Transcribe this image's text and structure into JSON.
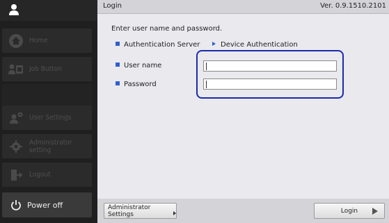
{
  "header": {
    "title": "Login",
    "version": "Ver. 0.9.1510.2101"
  },
  "sidebar": {
    "items": [
      {
        "label": "Home",
        "icon": "home-icon",
        "enabled": false
      },
      {
        "label": "Job Button",
        "icon": "job-button-icon",
        "enabled": false
      },
      {
        "label": "User Settings",
        "icon": "user-settings-icon",
        "enabled": false
      },
      {
        "label": "Administrator setting",
        "icon": "gear-icon",
        "enabled": false
      },
      {
        "label": "Logout",
        "icon": "logout-icon",
        "enabled": false
      }
    ],
    "power": {
      "label": "Power off",
      "icon": "power-icon"
    }
  },
  "main": {
    "instruction": "Enter user name and password.",
    "auth_server_label": "Authentication Server",
    "auth_server_value": "Device Authentication",
    "user_label": "User name",
    "user_value": "",
    "password_label": "Password",
    "password_value": ""
  },
  "footer": {
    "admin_settings_label": "Administrator Settings",
    "login_label": "Login"
  },
  "colors": {
    "accent": "#2f5fd0",
    "highlight": "#1b2aa8",
    "sidebar_bg": "#1f1f1f",
    "panel_bg": "#e9e9ee"
  }
}
